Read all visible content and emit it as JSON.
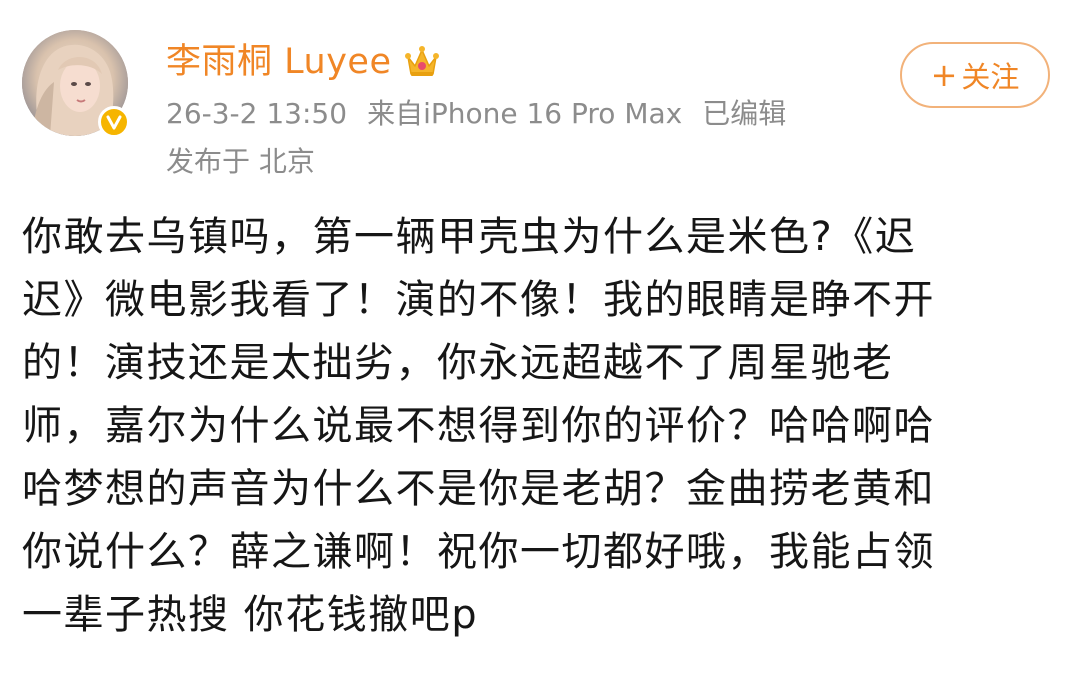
{
  "post": {
    "author": {
      "name": "李雨桐 Luyee"
    },
    "meta": {
      "timestamp": "26-3-2 13:50",
      "source": "来自iPhone 16 Pro Max",
      "edited": "已编辑",
      "location": "发布于 北京"
    },
    "follow_button": {
      "plus": "+",
      "label": "关注"
    },
    "body_lines": [
      "你敢去乌镇吗，第一辆甲壳虫为什么是米色?《迟",
      "迟》微电影我看了！演的不像！我的眼睛是睁不开",
      "的！演技还是太拙劣，你永远超越不了周星驰老",
      "师，嘉尔为什么说最不想得到你的评价？哈哈啊哈",
      "哈梦想的声音为什么不是你是老胡？金曲捞老黄和",
      "你说什么？薛之谦啊！祝你一切都好哦，我能占领",
      "一辈子热搜 你花钱撤吧p"
    ]
  },
  "icons": {
    "avatar": "avatar-photo",
    "verified": "verified-v-icon",
    "crown": "crown-icon",
    "plus": "plus-icon"
  },
  "colors": {
    "username": "#f08626",
    "meta_text": "#8c8c8c",
    "body_text": "#161616",
    "follow_border": "#f2b27a",
    "verified_badge": "#f6b500"
  }
}
